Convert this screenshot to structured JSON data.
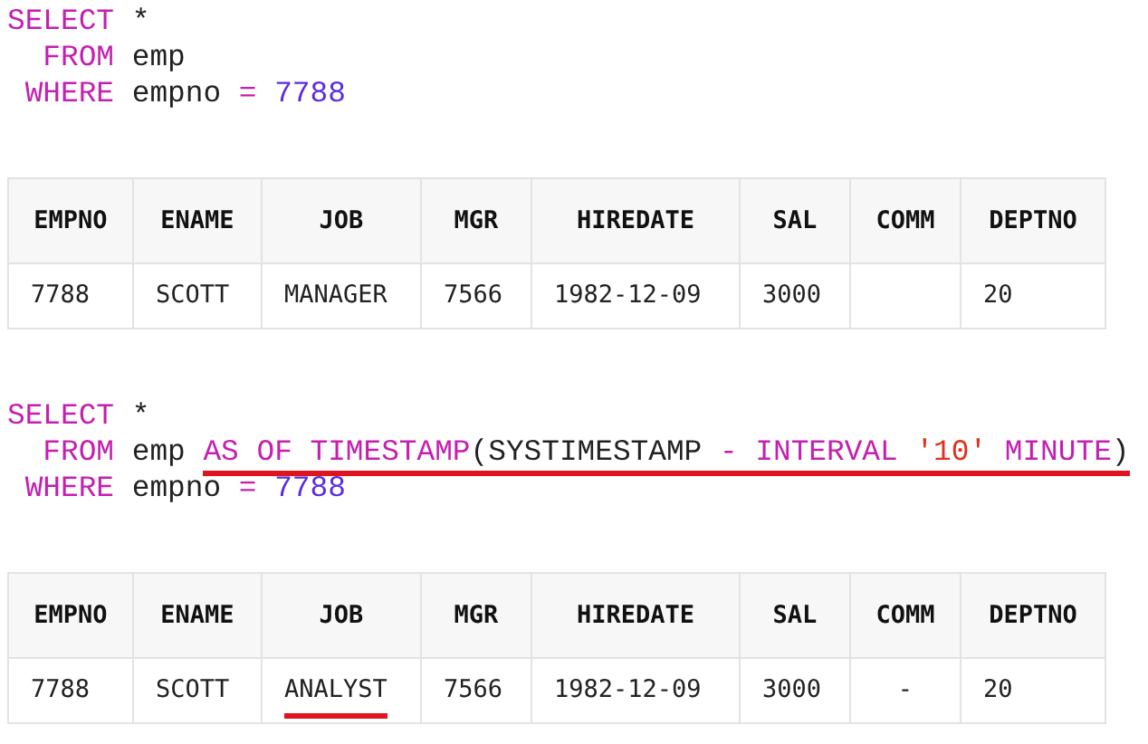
{
  "blocks": [
    {
      "code": [
        [
          {
            "kind": "keyword",
            "text": "SELECT"
          },
          {
            "kind": "plain",
            "text": " *"
          }
        ],
        [
          {
            "kind": "keyword",
            "text": "  FROM"
          },
          {
            "kind": "plain",
            "text": " emp"
          }
        ],
        [
          {
            "kind": "keyword",
            "text": " WHERE"
          },
          {
            "kind": "plain",
            "text": " empno "
          },
          {
            "kind": "operator",
            "text": "= "
          },
          {
            "kind": "number",
            "text": "7788"
          }
        ]
      ],
      "table": {
        "columns": [
          "EMPNO",
          "ENAME",
          "JOB",
          "MGR",
          "HIREDATE",
          "SAL",
          "COMM",
          "DEPTNO"
        ],
        "rows": [
          [
            {
              "text": "7788",
              "underlined": false
            },
            {
              "text": "SCOTT",
              "underlined": false
            },
            {
              "text": "MANAGER",
              "underlined": false
            },
            {
              "text": "7566",
              "underlined": false
            },
            {
              "text": "1982-12-09",
              "underlined": false
            },
            {
              "text": "3000",
              "underlined": false
            },
            {},
            {
              "text": "20",
              "underlined": false
            }
          ]
        ]
      }
    },
    {
      "code": [
        [
          {
            "kind": "keyword",
            "text": "SELECT"
          },
          {
            "kind": "plain",
            "text": " *"
          }
        ],
        [
          {
            "kind": "keyword",
            "text": "  FROM"
          },
          {
            "kind": "plain",
            "text": " emp "
          },
          {
            "kind": "keyword",
            "text": "AS OF TIMESTAMP",
            "underlined": true
          },
          {
            "kind": "plain",
            "text": "(SYSTIMESTAMP ",
            "underlined": true
          },
          {
            "kind": "keyword",
            "text": "- INTERVAL ",
            "underlined": true
          },
          {
            "kind": "string",
            "text": "'10'",
            "underlined": true
          },
          {
            "kind": "keyword",
            "text": " MINUTE",
            "underlined": true
          },
          {
            "kind": "plain",
            "text": ")",
            "underlined": true
          }
        ],
        [
          {
            "kind": "keyword",
            "text": " WHERE"
          },
          {
            "kind": "plain",
            "text": " empno "
          },
          {
            "kind": "operator",
            "text": "= "
          },
          {
            "kind": "number",
            "text": "7788"
          }
        ]
      ],
      "table": {
        "columns": [
          "EMPNO",
          "ENAME",
          "JOB",
          "MGR",
          "HIREDATE",
          "SAL",
          "COMM",
          "DEPTNO"
        ],
        "rows": [
          [
            {
              "text": "7788",
              "underlined": false
            },
            {
              "text": "SCOTT",
              "underlined": false
            },
            {
              "text": "ANALYST",
              "underlined": true
            },
            {
              "text": "7566",
              "underlined": false
            },
            {
              "text": "1982-12-09",
              "underlined": false
            },
            {
              "text": "3000",
              "underlined": false
            },
            {
              "text": "-",
              "underlined": false
            },
            {
              "text": "20",
              "underlined": false
            }
          ]
        ]
      }
    }
  ]
}
